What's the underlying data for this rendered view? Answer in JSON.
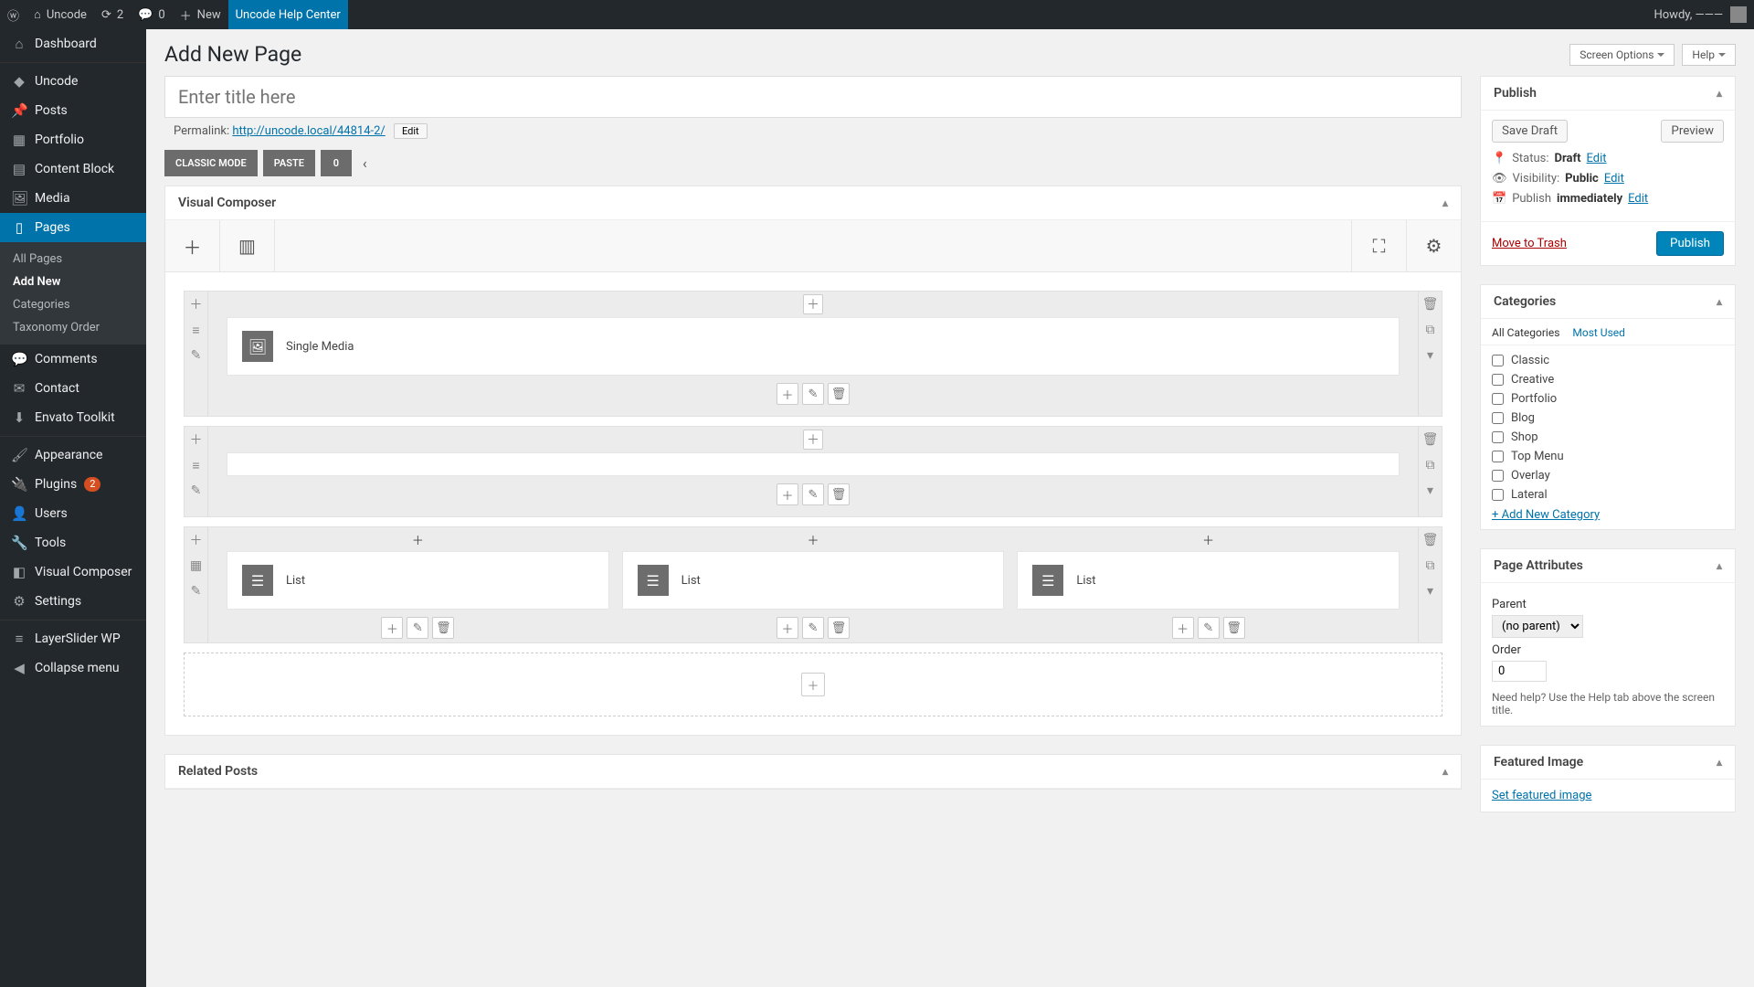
{
  "adminbar": {
    "site_name": "Uncode",
    "updates": "2",
    "comments": "0",
    "new": "New",
    "help_center": "Uncode Help Center",
    "howdy": "Howdy,",
    "username": "———"
  },
  "sidebar": {
    "items": [
      {
        "icon": "⌂",
        "label": "Dashboard"
      },
      {
        "icon": "◆",
        "label": "Uncode",
        "sep": true
      },
      {
        "icon": "📌",
        "label": "Posts"
      },
      {
        "icon": "▦",
        "label": "Portfolio"
      },
      {
        "icon": "▤",
        "label": "Content Block"
      },
      {
        "icon": "🖼",
        "label": "Media"
      },
      {
        "icon": "▯",
        "label": "Pages",
        "current": true
      },
      {
        "icon": "💬",
        "label": "Comments"
      },
      {
        "icon": "✉",
        "label": "Contact"
      },
      {
        "icon": "⬇",
        "label": "Envato Toolkit"
      },
      {
        "icon": "🖌",
        "label": "Appearance",
        "sep": true
      },
      {
        "icon": "🔌",
        "label": "Plugins",
        "badge": "2"
      },
      {
        "icon": "👤",
        "label": "Users"
      },
      {
        "icon": "🔧",
        "label": "Tools"
      },
      {
        "icon": "◧",
        "label": "Visual Composer"
      },
      {
        "icon": "⚙",
        "label": "Settings"
      },
      {
        "icon": "≡",
        "label": "LayerSlider WP",
        "sep": true
      },
      {
        "icon": "◀",
        "label": "Collapse menu"
      }
    ],
    "submenu": [
      {
        "label": "All Pages"
      },
      {
        "label": "Add New",
        "current": true
      },
      {
        "label": "Categories"
      },
      {
        "label": "Taxonomy Order"
      }
    ]
  },
  "top_toggles": {
    "screen_options": "Screen Options",
    "help": "Help"
  },
  "page": {
    "title": "Add New Page",
    "title_placeholder": "Enter title here",
    "permalink_label": "Permalink:",
    "permalink_url": "http://uncode.local/44814-2/",
    "edit": "Edit"
  },
  "editor_bar": {
    "classic": "CLASSIC MODE",
    "paste": "PASTE",
    "undo_count": "0"
  },
  "vc": {
    "panel_title": "Visual Composer",
    "elements": {
      "single_media": "Single Media",
      "list": "List"
    }
  },
  "related_posts_title": "Related Posts",
  "publish": {
    "title": "Publish",
    "save_draft": "Save Draft",
    "preview": "Preview",
    "status_label": "Status:",
    "status_value": "Draft",
    "visibility_label": "Visibility:",
    "visibility_value": "Public",
    "publish_label": "Publish",
    "publish_value": "immediately",
    "edit": "Edit",
    "trash": "Move to Trash",
    "publish_btn": "Publish"
  },
  "categories": {
    "title": "Categories",
    "tab_all": "All Categories",
    "tab_most": "Most Used",
    "items": [
      "Classic",
      "Creative",
      "Portfolio",
      "Blog",
      "Shop",
      "Top Menu",
      "Overlay",
      "Lateral"
    ],
    "add_new": "+ Add New Category"
  },
  "attributes": {
    "title": "Page Attributes",
    "parent_label": "Parent",
    "parent_value": "(no parent)",
    "order_label": "Order",
    "order_value": "0",
    "help": "Need help? Use the Help tab above the screen title."
  },
  "featured": {
    "title": "Featured Image",
    "link": "Set featured image"
  }
}
